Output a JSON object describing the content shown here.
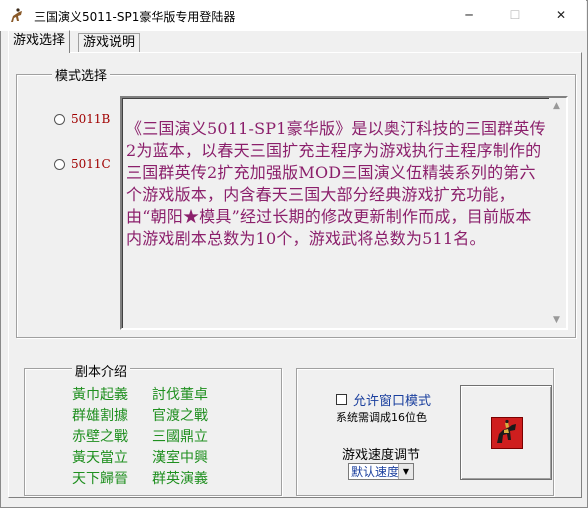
{
  "window": {
    "title": "三国演义5011-SP1豪华版专用登陆器",
    "app_icon": "horse-rider-icon",
    "controls": {
      "minimize": "─",
      "maximize": "☐",
      "close": "✕"
    }
  },
  "tabs": [
    {
      "label": "游戏选择",
      "active": true
    },
    {
      "label": "游戏说明",
      "active": false
    }
  ],
  "mode_select": {
    "legend": "模式选择",
    "options": [
      {
        "label": "5011B",
        "selected": false
      },
      {
        "label": "5011C",
        "selected": false
      }
    ],
    "description": "《三国演义5011-SP1豪华版》是以奥汀科技的三国群英传2为蓝本，以春天三国扩充主程序为游戏执行主程序制作的三国群英传2扩充加强版MOD三国演义伍精装系列的第六个游戏版本，内含春天三国大部分经典游戏扩充功能，由“朝阳★模具”经过长期的修改更新制作而成，目前版本内游戏剧本总数为10个，游戏武将总数为511名。"
  },
  "scripts": {
    "legend": "剧本介绍",
    "items": [
      "黃巾起義",
      "討伐董卓",
      "群雄割據",
      "官渡之戰",
      "赤壁之戰",
      "三國鼎立",
      "黃天當立",
      "漢室中興",
      "天下歸晉",
      "群英演義"
    ]
  },
  "options": {
    "window_mode_label": "允许窗口模式",
    "window_mode_checked": false,
    "note": "系统需调成16位色",
    "speed_label": "游戏速度调节",
    "speed_value": "默认速度"
  },
  "start_button": {
    "icon": "horse-rider-icon"
  },
  "colors": {
    "description_text": "#8b1f6b",
    "radio_label": "#a00000",
    "script_text": "#1f8f1f",
    "link_text": "#1a3f9e",
    "start_icon_bg": "#cf1e1e"
  }
}
